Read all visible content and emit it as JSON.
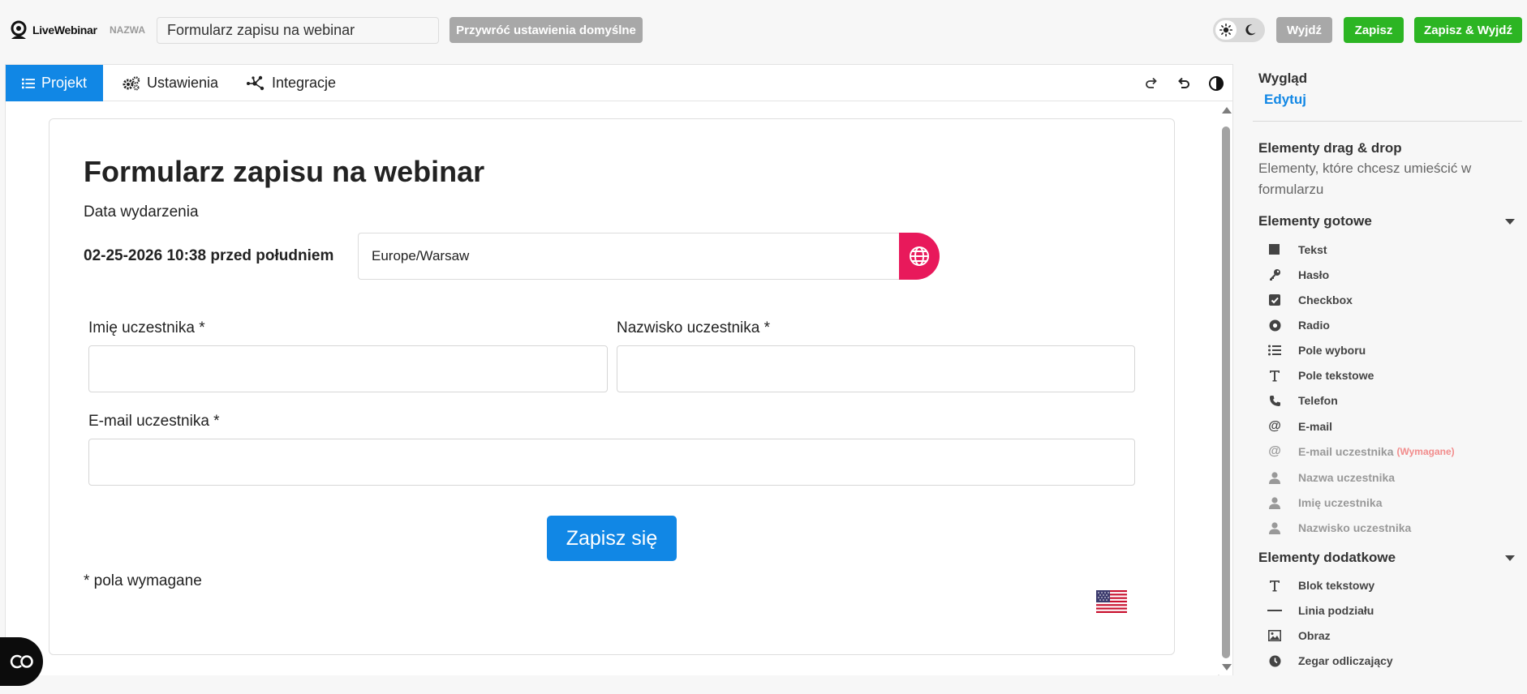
{
  "header": {
    "logo_text": "LiveWebinar",
    "name_label": "NAZWA",
    "name_value": "Formularz zapisu na webinar",
    "reset_label": "Przywróć ustawienia domyślne",
    "exit_label": "Wyjdź",
    "save_label": "Zapisz",
    "save_exit_label": "Zapisz & Wyjdź"
  },
  "tabs": [
    {
      "label": "Projekt",
      "icon": "list-icon",
      "active": true
    },
    {
      "label": "Ustawienia",
      "icon": "gears-icon",
      "active": false
    },
    {
      "label": "Integracje",
      "icon": "network-icon",
      "active": false
    }
  ],
  "form": {
    "title": "Formularz zapisu na webinar",
    "event_label": "Data wydarzenia",
    "event_date": "02-25-2026 10:38 przed południem",
    "timezone": "Europe/Warsaw",
    "first_name_label": "Imię uczestnika *",
    "last_name_label": "Nazwisko uczestnika *",
    "email_label": "E-mail uczestnika *",
    "submit_label": "Zapisz się",
    "required_note": "* pola wymagane"
  },
  "sidebar": {
    "appearance_title": "Wygląd",
    "appearance_edit": "Edytuj",
    "dnd_title": "Elementy drag & drop",
    "dnd_desc": "Elementy, które chcesz umieścić w formularzu",
    "ready_title": "Elementy gotowe",
    "ready_items": [
      {
        "label": "Tekst",
        "icon": "square-icon"
      },
      {
        "label": "Hasło",
        "icon": "key-icon"
      },
      {
        "label": "Checkbox",
        "icon": "checkbox-icon"
      },
      {
        "label": "Radio",
        "icon": "radio-icon"
      },
      {
        "label": "Pole wyboru",
        "icon": "list-icon"
      },
      {
        "label": "Pole tekstowe",
        "icon": "text-icon"
      },
      {
        "label": "Telefon",
        "icon": "phone-icon"
      },
      {
        "label": "E-mail",
        "icon": "at-icon"
      },
      {
        "label": "E-mail uczestnika",
        "icon": "at-icon",
        "required_tag": "(Wymagane)"
      },
      {
        "label": "Nazwa uczestnika",
        "icon": "user-icon"
      },
      {
        "label": "Imię uczestnika",
        "icon": "user-icon"
      },
      {
        "label": "Nazwisko uczestnika",
        "icon": "user-icon"
      }
    ],
    "extra_title": "Elementy dodatkowe",
    "extra_items": [
      {
        "label": "Blok tekstowy",
        "icon": "text-icon"
      },
      {
        "label": "Linia podziału",
        "icon": "line-icon"
      },
      {
        "label": "Obraz",
        "icon": "image-icon"
      },
      {
        "label": "Zegar odliczający",
        "icon": "clock-icon"
      }
    ]
  },
  "colors": {
    "accent_blue": "#1187e5",
    "save_green": "#2cb523",
    "globe_pink": "#e8195b",
    "neutral_button": "#a8a8a8"
  }
}
